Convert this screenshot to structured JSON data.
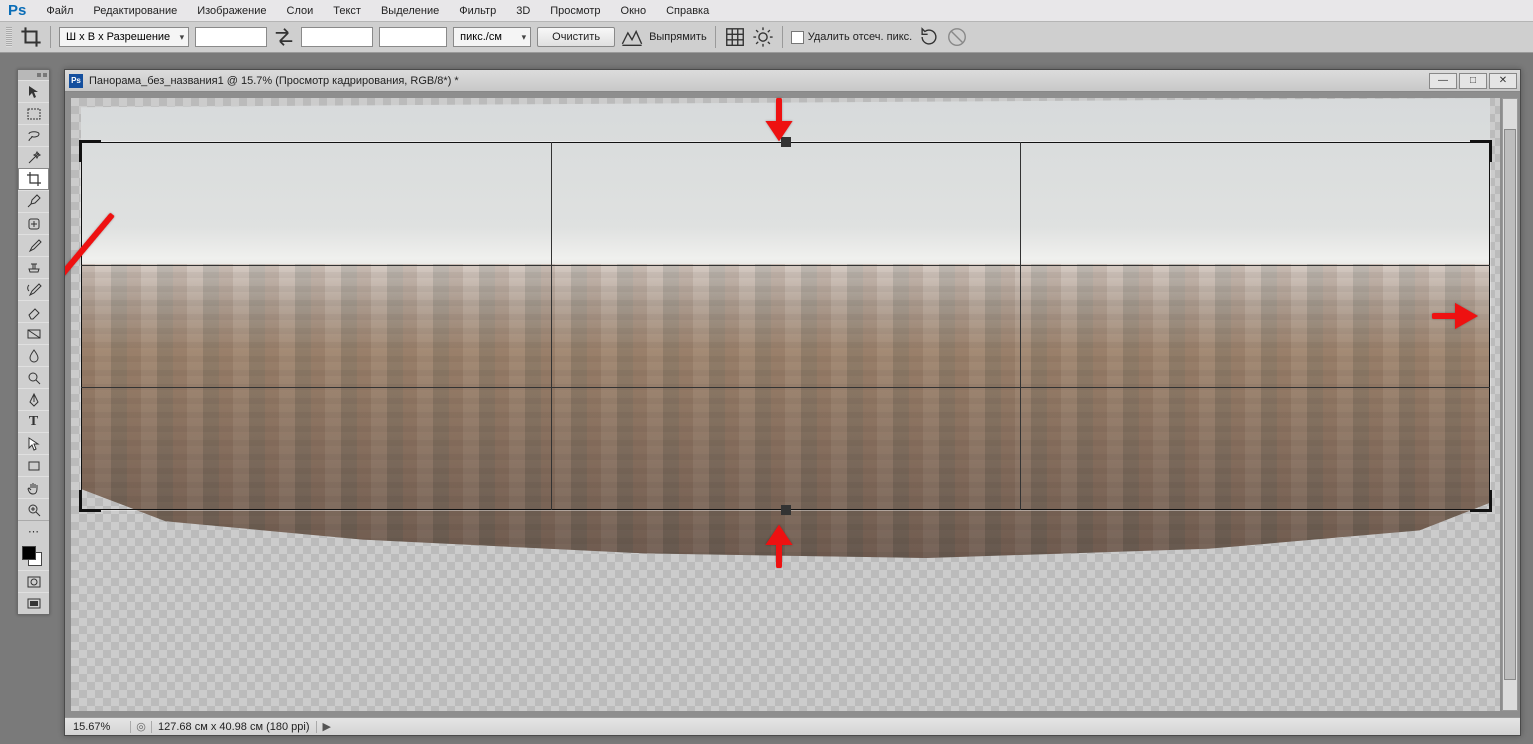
{
  "app": {
    "logo": "Ps"
  },
  "menu": [
    "Файл",
    "Редактирование",
    "Изображение",
    "Слои",
    "Текст",
    "Выделение",
    "Фильтр",
    "3D",
    "Просмотр",
    "Окно",
    "Справка"
  ],
  "options": {
    "ratio_preset": "Ш x В x Разрешение",
    "width": "",
    "height": "",
    "resolution": "",
    "units": "пикс./см",
    "clear_btn": "Очистить",
    "straighten_btn": "Выпрямить",
    "delete_cropped_label": "Удалить отсеч. пикс."
  },
  "document": {
    "title": "Панорама_без_названия1 @ 15.7% (Просмотр кадрирования, RGB/8*) *"
  },
  "status": {
    "zoom": "15.67%",
    "info": "127.68 см x 40.98 см (180 ppi)"
  },
  "tools": [
    {
      "name": "move-tool",
      "glyph": "↖"
    },
    {
      "name": "marquee-tool",
      "glyph": "▭"
    },
    {
      "name": "lasso-tool",
      "glyph": "⟆"
    },
    {
      "name": "magic-wand-tool",
      "glyph": "✧"
    },
    {
      "name": "crop-tool",
      "glyph": "✂",
      "active": true
    },
    {
      "name": "eyedropper-tool",
      "glyph": "✎"
    },
    {
      "name": "healing-brush-tool",
      "glyph": "◍"
    },
    {
      "name": "brush-tool",
      "glyph": "🖌"
    },
    {
      "name": "clone-stamp-tool",
      "glyph": "⎌"
    },
    {
      "name": "history-brush-tool",
      "glyph": "↺"
    },
    {
      "name": "eraser-tool",
      "glyph": "◧"
    },
    {
      "name": "gradient-tool",
      "glyph": "◐"
    },
    {
      "name": "blur-tool",
      "glyph": "○"
    },
    {
      "name": "dodge-tool",
      "glyph": "◯"
    },
    {
      "name": "pen-tool",
      "glyph": "✒"
    },
    {
      "name": "type-tool",
      "glyph": "T"
    },
    {
      "name": "path-selection-tool",
      "glyph": "↗"
    },
    {
      "name": "shape-tool",
      "glyph": "▭"
    },
    {
      "name": "hand-tool",
      "glyph": "✋"
    },
    {
      "name": "zoom-tool",
      "glyph": "🔍"
    }
  ],
  "extra_tools": [
    {
      "name": "edit-toolbar",
      "glyph": "⋯"
    },
    {
      "name": "quick-mask-toggle",
      "glyph": "◻"
    },
    {
      "name": "screen-mode-toggle",
      "glyph": "▣"
    }
  ]
}
